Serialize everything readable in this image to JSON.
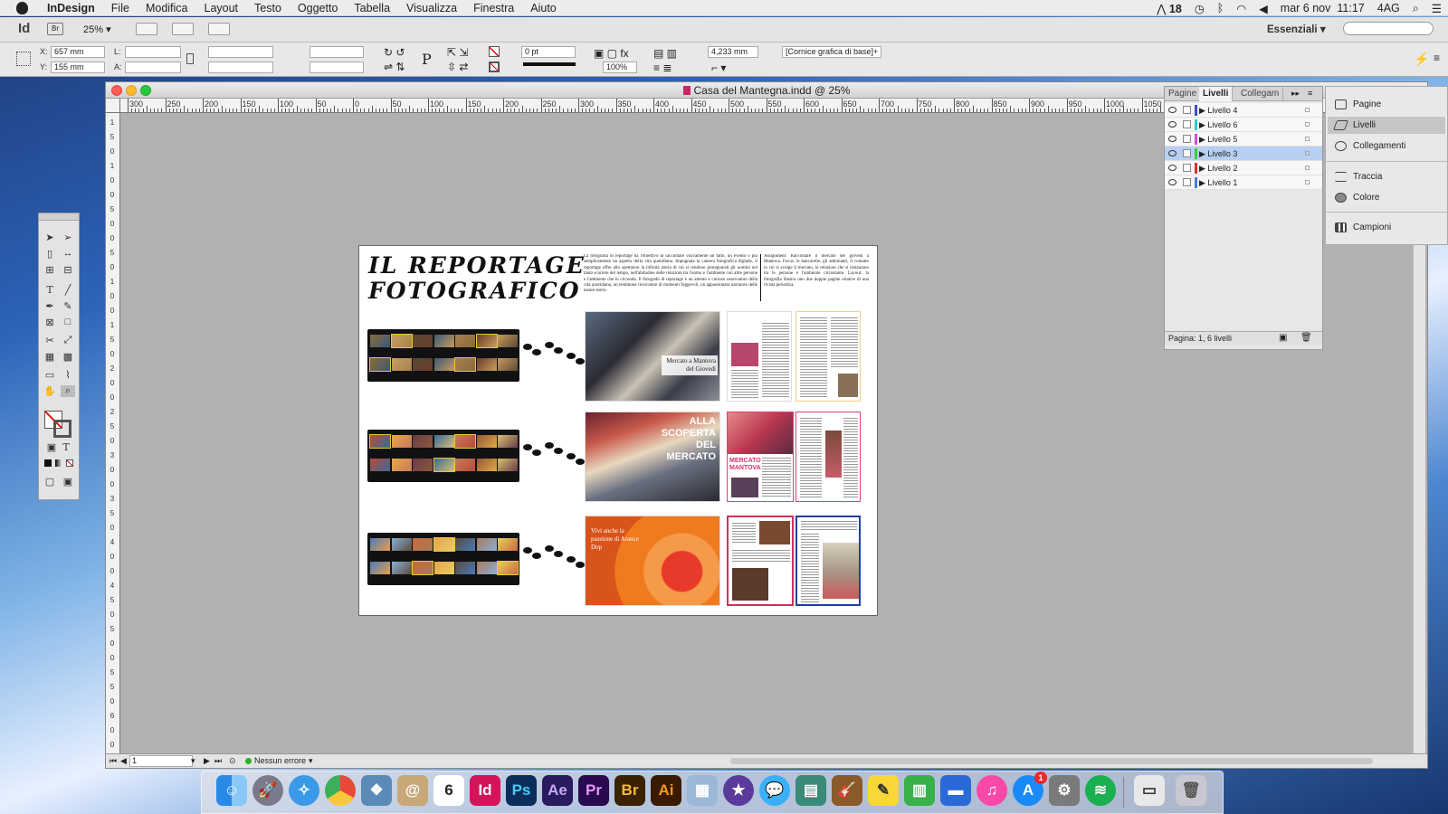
{
  "menubar": {
    "app": "InDesign",
    "items": [
      "File",
      "Modifica",
      "Layout",
      "Testo",
      "Oggetto",
      "Tabella",
      "Visualizza",
      "Finestra",
      "Aiuto"
    ],
    "status": {
      "adobe_badge": "18",
      "date": "mar 6 nov",
      "time": "11:17",
      "user": "4AG"
    }
  },
  "topbar": {
    "app_badge": "Id",
    "bridge_badge": "Br",
    "zoom": "25%",
    "workspace": "Essenziali",
    "search_placeholder": ""
  },
  "control": {
    "x_label": "X:",
    "x_value": "657 mm",
    "y_label": "Y:",
    "y_value": "155 mm",
    "l_label": "L:",
    "a_label": "A:",
    "stroke_weight": "0 pt",
    "opacity": "100%",
    "size_value": "4,233 mm",
    "object_style": "[Cornice grafica di base]+"
  },
  "document": {
    "title": "Casa del Mantegna.indd @ 25%",
    "ruler_labels": [
      "300",
      "250",
      "200",
      "150",
      "100",
      "50",
      "0",
      "50",
      "100",
      "150",
      "200",
      "250",
      "300",
      "350",
      "400",
      "450",
      "500",
      "550",
      "600",
      "650",
      "700",
      "750",
      "800",
      "850",
      "900",
      "950",
      "1000",
      "1050"
    ],
    "vruler_labels": [
      "1",
      "5",
      "0",
      "1",
      "0",
      "0",
      "5",
      "0",
      "0",
      "5",
      "0",
      "1",
      "0",
      "0",
      "1",
      "5",
      "0",
      "2",
      "0",
      "0",
      "2",
      "5",
      "0",
      "3",
      "0",
      "0",
      "3",
      "5",
      "0",
      "4",
      "0",
      "0",
      "4",
      "5",
      "0",
      "5",
      "0",
      "0",
      "5",
      "5",
      "0",
      "6",
      "0",
      "0"
    ],
    "page_number": "1",
    "preflight": "Nessun errore"
  },
  "page_content": {
    "headline_line1": "IL REPORTAGE",
    "headline_line2": "FOTOGRAFICO",
    "col1_text": "La fotografia di reportage ha l'obiettivo di raccontare visivamente un fatto, un evento o più semplicemente un aspetto della vita quotidiana. Impugnata la camera fotografica digitale, il reportage offre allo spettatore la infinita storia di cui si rendono protagonisti gli uomini nel tanto scorrere del tempo, nell'abitudine delle relazioni tra l'uomo e l'ambiente con altre persone e l'ambiente che lo circonda. Il fotografo di reportage è un attento e curioso osservatore della vita quotidiana, un testimone ricercatore di momenti fuggevoli, un appassionato narratore delle nostre storie.",
    "col2_text": "Assignment: Raccontare il mercato del giovedì a Mantova. Focus: le bancarelle, gli ambulanti, il contatto in cui si svolge il mercato, le relazioni che si instaurano tra le persone e l'ambiente circostante. Layout: la fotografia illustra uno due doppie pagine relative di una rivista periodica.",
    "spread1_caption": "Mercato a Mantova del Giovedì",
    "spread2_caption": [
      "ALLA",
      "SCOPERTA",
      "DEL",
      "MERCATO"
    ],
    "spread2_mini_title": "MERCATO MANTOVA",
    "spread3_caption": "Vivi anche la passione di Arance Dop"
  },
  "layers_panel": {
    "tabs": [
      "Pagine",
      "Livelli",
      "Collegam"
    ],
    "layers": [
      {
        "name": "Livello 4",
        "color": "#3b4bd6",
        "selected": false
      },
      {
        "name": "Livello 6",
        "color": "#2ad0d0",
        "selected": false
      },
      {
        "name": "Livello 5",
        "color": "#d84bd8",
        "selected": false
      },
      {
        "name": "Livello 3",
        "color": "#3bcc3b",
        "selected": true
      },
      {
        "name": "Livello 2",
        "color": "#e03030",
        "selected": false
      },
      {
        "name": "Livello 1",
        "color": "#4a7ae8",
        "selected": false
      }
    ],
    "footer": "Pagina: 1, 6 livelli"
  },
  "side_dock": {
    "items": [
      "Pagine",
      "Livelli",
      "Collegamenti",
      "Traccia",
      "Colore",
      "Campioni"
    ],
    "active": "Livelli"
  },
  "mac_dock": {
    "calendar_day": "6",
    "apps": [
      {
        "label": "Id",
        "color": "#d4145a"
      },
      {
        "label": "Ps",
        "color": "#0a2d5a"
      },
      {
        "label": "Ae",
        "color": "#3a1f6e"
      },
      {
        "label": "Pr",
        "color": "#3a1a5e"
      },
      {
        "label": "Br",
        "color": "#5a3a0e"
      },
      {
        "label": "Ai",
        "color": "#4a2a00"
      }
    ],
    "appstore_badge": "1"
  }
}
